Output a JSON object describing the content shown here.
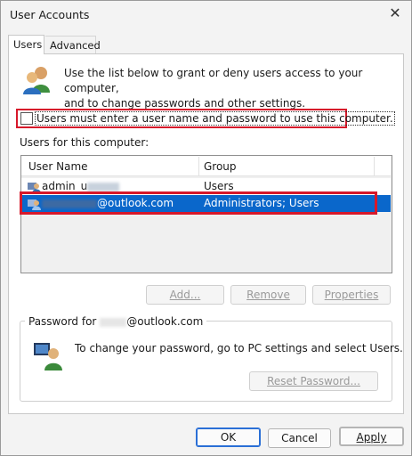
{
  "window": {
    "title": "User Accounts",
    "close_glyph": "✕"
  },
  "tabs": [
    {
      "label": "Users"
    },
    {
      "label": "Advanced"
    }
  ],
  "intro": {
    "line1": "Use the list below to grant or deny users access to your computer,",
    "line2": "and to change passwords and other settings."
  },
  "require_login": {
    "label": "Users must enter a user name and password to use this computer.",
    "checked": false
  },
  "users_list": {
    "caption": "Users for this computer:",
    "columns": [
      "User Name",
      "Group"
    ],
    "rows": [
      {
        "name_visible": "admin_u",
        "group": "Users",
        "selected": false
      },
      {
        "name_visible": "@outlook.com",
        "group": "Administrators; Users",
        "selected": true
      }
    ]
  },
  "list_buttons": {
    "add": "Add...",
    "remove": "Remove",
    "properties": "Properties"
  },
  "password_group": {
    "legend_prefix": "Password for",
    "legend_suffix": "@outlook.com",
    "text": "To change your password, go to PC settings and select Users.",
    "reset_button": "Reset Password..."
  },
  "dialog_buttons": {
    "ok": "OK",
    "cancel": "Cancel",
    "apply": "Apply"
  },
  "colors": {
    "accent_selection": "#0a67cb",
    "highlight_outline": "#d7182a"
  }
}
